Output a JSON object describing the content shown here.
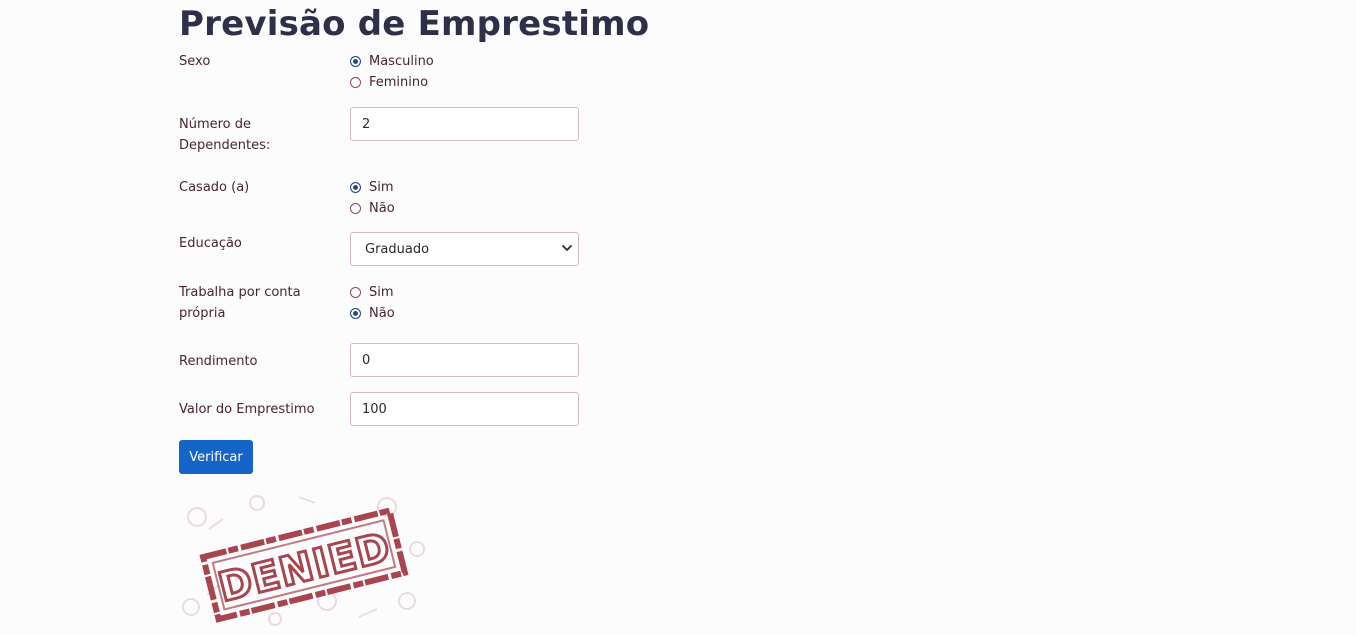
{
  "title": "Previsão de Emprestimo",
  "form": {
    "sexo": {
      "label": "Sexo",
      "options": [
        {
          "label": "Masculino",
          "checked": true
        },
        {
          "label": "Feminino",
          "checked": false
        }
      ]
    },
    "dependentes": {
      "label_line1": "Número de",
      "label_line2": "Dependentes:",
      "value": "2"
    },
    "casado": {
      "label": "Casado (a)",
      "options": [
        {
          "label": "Sim",
          "checked": true
        },
        {
          "label": "Não",
          "checked": false
        }
      ]
    },
    "educacao": {
      "label": "Educação",
      "selected": "Graduado"
    },
    "trabalha": {
      "label_line1": "Trabalha por conta",
      "label_line2": "própria",
      "options": [
        {
          "label": "Sim",
          "checked": false
        },
        {
          "label": "Não",
          "checked": true
        }
      ]
    },
    "rendimento": {
      "label": "Rendimento",
      "value": "0"
    },
    "valor": {
      "label": "Valor do Emprestimo",
      "value": "100"
    },
    "submit_label": "Verificar"
  },
  "result": {
    "stamp_text": "DENIED",
    "stamp_color": "#a8454f"
  }
}
